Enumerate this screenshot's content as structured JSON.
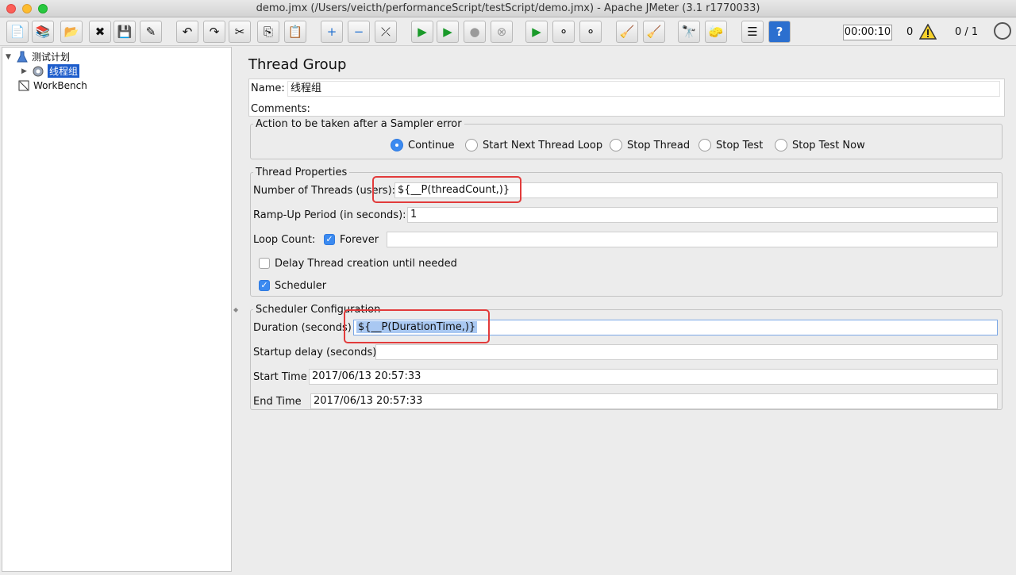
{
  "window": {
    "title": "demo.jmx (/Users/veicth/performanceScript/testScript/demo.jmx) - Apache JMeter (3.1 r1770033)"
  },
  "toolbar": {
    "timer": "00:00:10",
    "error_count": "0",
    "thread_count": "0 / 1",
    "buttons": [
      {
        "name": "new-icon",
        "glyph": "📄"
      },
      {
        "name": "templates-icon",
        "glyph": "📚"
      },
      {
        "name": "open-icon",
        "glyph": "📂"
      },
      {
        "name": "close-icon",
        "glyph": "✖"
      },
      {
        "name": "save-icon",
        "glyph": "💾"
      },
      {
        "name": "save-as-icon",
        "glyph": "✎"
      },
      {
        "name": "undo-icon",
        "glyph": "↶"
      },
      {
        "name": "redo-icon",
        "glyph": "↷"
      },
      {
        "name": "cut-icon",
        "glyph": "✂"
      },
      {
        "name": "copy-icon",
        "glyph": "⎘"
      },
      {
        "name": "paste-icon",
        "glyph": "📋"
      },
      {
        "name": "expand-icon",
        "glyph": "+"
      },
      {
        "name": "collapse-icon",
        "glyph": "−"
      },
      {
        "name": "toggle-icon",
        "glyph": "⤫"
      },
      {
        "name": "start-icon",
        "glyph": "▶"
      },
      {
        "name": "start-no-pause-icon",
        "glyph": "▶"
      },
      {
        "name": "stop-icon",
        "glyph": "●"
      },
      {
        "name": "shutdown-icon",
        "glyph": "⊗"
      },
      {
        "name": "remote-start-icon",
        "glyph": "▶"
      },
      {
        "name": "remote-stop-icon",
        "glyph": "⚬"
      },
      {
        "name": "remote-shutdown-icon",
        "glyph": "⚬"
      },
      {
        "name": "clear-icon",
        "glyph": "🧹"
      },
      {
        "name": "clear-all-icon",
        "glyph": "🧹"
      },
      {
        "name": "search-icon",
        "glyph": "🔭"
      },
      {
        "name": "reset-search-icon",
        "glyph": "🧽"
      },
      {
        "name": "function-helper-icon",
        "glyph": "☰"
      },
      {
        "name": "help-icon",
        "glyph": "?"
      }
    ]
  },
  "tree": {
    "test_plan": "测试计划",
    "thread_group": "线程组",
    "workbench": "WorkBench"
  },
  "panel": {
    "title": "Thread Group",
    "name_label": "Name:",
    "name_value": "线程组",
    "comments_label": "Comments:",
    "error_action": {
      "legend": "Action to be taken after a Sampler error",
      "options": [
        "Continue",
        "Start Next Thread Loop",
        "Stop Thread",
        "Stop Test",
        "Stop Test Now"
      ],
      "selected": "Continue"
    },
    "thread_props": {
      "legend": "Thread Properties",
      "threads_label": "Number of Threads (users):",
      "threads_value": "${__P(threadCount,)}",
      "rampup_label": "Ramp-Up Period (in seconds):",
      "rampup_value": "1",
      "loop_label": "Loop Count:",
      "forever_label": "Forever",
      "forever_checked": true,
      "delay_label": "Delay Thread creation until needed",
      "delay_checked": false,
      "scheduler_label": "Scheduler",
      "scheduler_checked": true
    },
    "scheduler": {
      "legend": "Scheduler Configuration",
      "duration_label": "Duration (seconds)",
      "duration_value": "${__P(DurationTime,)}",
      "startup_label": "Startup delay (seconds)",
      "startup_value": "",
      "start_label": "Start Time",
      "start_value": "2017/06/13 20:57:33",
      "end_label": "End Time",
      "end_value": "2017/06/13 20:57:33"
    }
  }
}
